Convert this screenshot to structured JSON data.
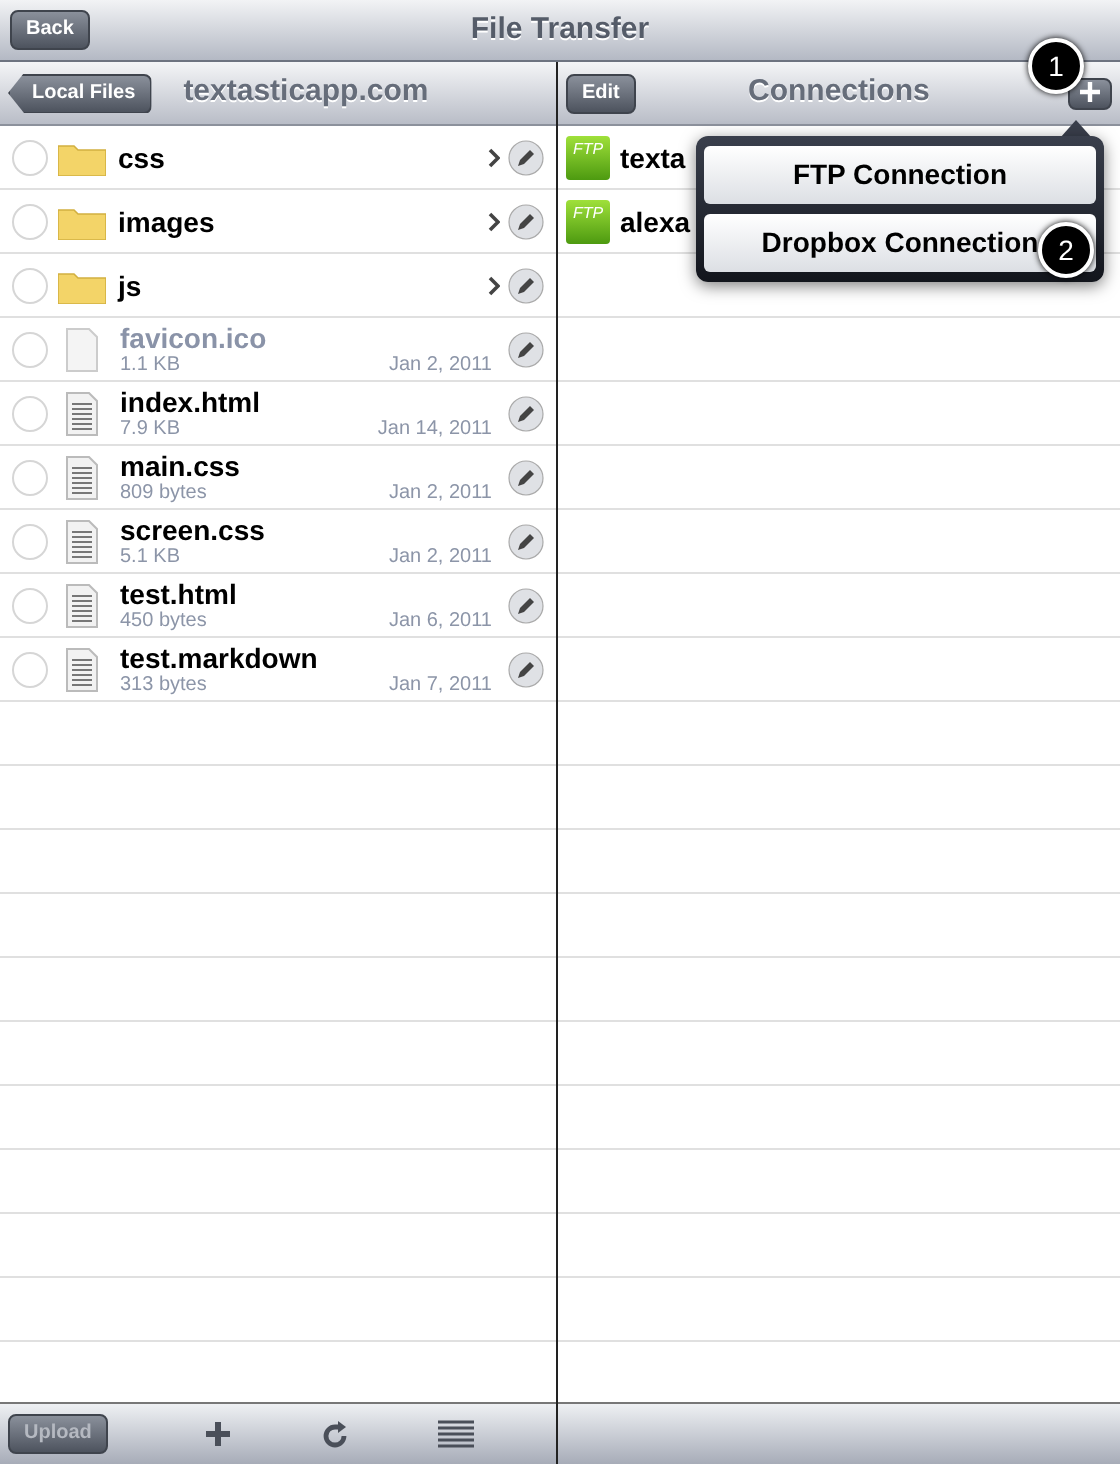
{
  "window": {
    "title": "File Transfer",
    "back_button": "Back"
  },
  "local_pane": {
    "back_button": "Local Files",
    "title": "textasticapp.com",
    "items": [
      {
        "kind": "folder",
        "name": "css",
        "selected": false
      },
      {
        "kind": "folder",
        "name": "images",
        "selected": false
      },
      {
        "kind": "folder",
        "name": "js",
        "selected": false
      },
      {
        "kind": "other-file",
        "name": "favicon.ico",
        "size": "1.1 KB",
        "date": "Jan 2, 2011",
        "selected": false
      },
      {
        "kind": "text-file",
        "name": "index.html",
        "size": "7.9 KB",
        "date": "Jan 14, 2011",
        "selected": false
      },
      {
        "kind": "text-file",
        "name": "main.css",
        "size": "809 bytes",
        "date": "Jan 2, 2011",
        "selected": false
      },
      {
        "kind": "text-file",
        "name": "screen.css",
        "size": "5.1 KB",
        "date": "Jan 2, 2011",
        "selected": false
      },
      {
        "kind": "text-file",
        "name": "test.html",
        "size": "450 bytes",
        "date": "Jan 6, 2011",
        "selected": false
      },
      {
        "kind": "text-file",
        "name": "test.markdown",
        "size": "313 bytes",
        "date": "Jan 7, 2011",
        "selected": false
      }
    ],
    "toolbar": {
      "upload_button": "Upload",
      "upload_disabled": true
    }
  },
  "connections_pane": {
    "edit_button": "Edit",
    "title": "Connections",
    "items": [
      {
        "icon_label": "FTP",
        "name": "texta"
      },
      {
        "icon_label": "FTP",
        "name": "alexa"
      }
    ]
  },
  "popover": {
    "items": [
      "FTP Connection",
      "Dropbox Connection"
    ]
  },
  "callouts": [
    "1",
    "2"
  ]
}
